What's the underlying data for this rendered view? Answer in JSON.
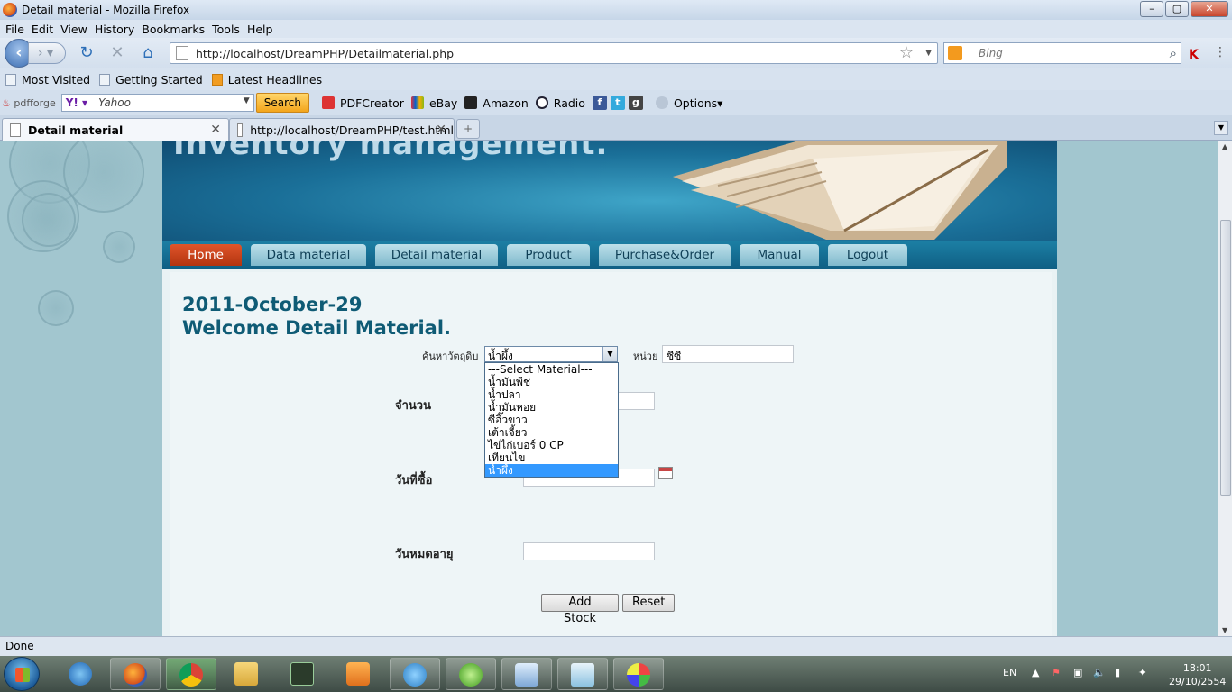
{
  "window": {
    "title": "Detail material - Mozilla Firefox"
  },
  "menubar": [
    "File",
    "Edit",
    "View",
    "History",
    "Bookmarks",
    "Tools",
    "Help"
  ],
  "address": {
    "url": "http://localhost/DreamPHP/Detailmaterial.php"
  },
  "search": {
    "placeholder": "Bing"
  },
  "bookmarks": [
    "Most Visited",
    "Getting Started",
    "Latest Headlines"
  ],
  "toolbar2": {
    "pdfforge": "pdfforge",
    "yahoo_label": "Yahoo",
    "search_button": "Search",
    "items": [
      "PDFCreator",
      "eBay",
      "Amazon",
      "Radio"
    ],
    "options": "Options"
  },
  "tabs": [
    {
      "label": "Detail material",
      "active": true
    },
    {
      "label": "http://localhost/DreamPHP/test.html",
      "active": false
    }
  ],
  "site": {
    "header_title": "Inventory management.",
    "menu": [
      "Home",
      "Data material",
      "Detail material",
      "Product",
      "Purchase&Order",
      "Manual",
      "Logout"
    ],
    "date": "2011-October-29",
    "welcome": "Welcome Detail Material."
  },
  "form": {
    "search_material_label": "ค้นหาวัตถุดิบ",
    "selected_material": "น้ำผึ้ง",
    "unit_label": "หน่วย",
    "unit_value": "ซีซี",
    "quantity_label": "จำนวน",
    "purchase_date_label": "วันที่ซื้อ",
    "expire_date_label": "วันหมดอายุ",
    "options": [
      "---Select Material---",
      "น้ำมันพืช",
      "น้ำปลา",
      "น้ำมันหอย",
      "ซีอิ๊วขาว",
      "เต้าเจี้ยว",
      "ไข่ไก่เบอร์ 0 CP",
      "เทียนไข",
      "น้ำผึ้ง"
    ],
    "highlighted_option": "น้ำผึ้ง",
    "add_button": "Add Stock",
    "reset_button": "Reset"
  },
  "status": {
    "text": "Done"
  },
  "taskbar": {
    "language": "EN",
    "time": "18:01",
    "date": "29/10/2554"
  }
}
